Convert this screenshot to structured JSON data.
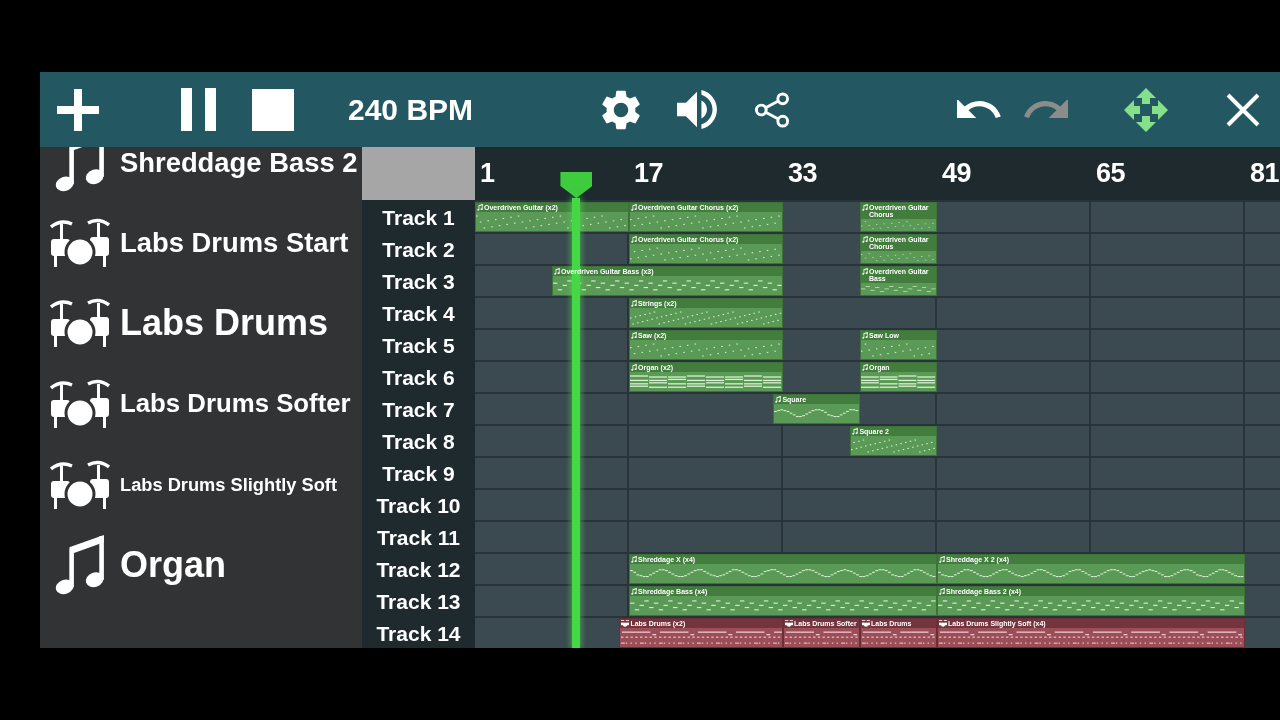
{
  "toolbar": {
    "transport": [
      {
        "kind": "add"
      },
      {
        "kind": "pause"
      },
      {
        "kind": "stop"
      }
    ],
    "tempo": "240 BPM",
    "tools": [
      {
        "kind": "settings"
      },
      {
        "kind": "volume"
      },
      {
        "kind": "share"
      }
    ],
    "history": [
      {
        "kind": "undo",
        "disabled": false
      },
      {
        "kind": "redo",
        "disabled": true
      }
    ],
    "view": [
      {
        "kind": "move",
        "active": true
      },
      {
        "kind": "close",
        "active": false
      }
    ]
  },
  "instruments": [
    {
      "name": "Shreddage Bass 2",
      "kind": "melodic"
    },
    {
      "name": "Labs Drums Start",
      "kind": "drums"
    },
    {
      "name": "Labs Drums",
      "kind": "drums"
    },
    {
      "name": "Labs Drums Softer",
      "kind": "drums"
    },
    {
      "name": "Labs Drums Slightly Soft",
      "kind": "drums"
    },
    {
      "name": "Organ",
      "kind": "melodic"
    }
  ],
  "ruler": {
    "marks": [
      "1",
      "17",
      "33",
      "49",
      "65",
      "81"
    ]
  },
  "playhead": {
    "level": 0.126
  },
  "tracks": [
    {
      "name": "Track 1",
      "clips": [
        {
          "name": "Overdriven Guitar (x2)",
          "kind": "melodic"
        },
        {
          "name": "Overdriven Guitar Chorus (x2)",
          "kind": "melodic"
        },
        {
          "name": "Overdriven Guitar Chorus",
          "kind": "melodic"
        }
      ]
    },
    {
      "name": "Track 2",
      "clips": [
        {
          "name": "Overdriven Guitar Chorus (x2)",
          "kind": "melodic"
        },
        {
          "name": "Overdriven Guitar Chorus",
          "kind": "melodic"
        }
      ]
    },
    {
      "name": "Track 3",
      "clips": [
        {
          "name": "Overdriven Guitar Bass (x3)",
          "kind": "melodic"
        },
        {
          "name": "Overdriven Guitar Bass",
          "kind": "melodic"
        }
      ]
    },
    {
      "name": "Track 4",
      "clips": [
        {
          "name": "Strings (x2)",
          "kind": "melodic"
        }
      ]
    },
    {
      "name": "Track 5",
      "clips": [
        {
          "name": "Saw (x2)",
          "kind": "melodic"
        },
        {
          "name": "Saw Low",
          "kind": "melodic"
        }
      ]
    },
    {
      "name": "Track 6",
      "clips": [
        {
          "name": "Organ (x2)",
          "kind": "melodic"
        },
        {
          "name": "Organ",
          "kind": "melodic"
        }
      ]
    },
    {
      "name": "Track 7",
      "clips": [
        {
          "name": "Square",
          "kind": "melodic"
        }
      ]
    },
    {
      "name": "Track 8",
      "clips": [
        {
          "name": "Square 2",
          "kind": "melodic"
        }
      ]
    },
    {
      "name": "Track 9"
    },
    {
      "name": "Track 10"
    },
    {
      "name": "Track 11"
    },
    {
      "name": "Track 12",
      "clips": [
        {
          "name": "Shreddage X (x4)",
          "kind": "melodic"
        },
        {
          "name": "Shreddage X 2 (x4)",
          "kind": "melodic"
        }
      ]
    },
    {
      "name": "Track 13",
      "clips": [
        {
          "name": "Shreddage Bass (x4)",
          "kind": "melodic"
        },
        {
          "name": "Shreddage Bass 2 (x4)",
          "kind": "melodic"
        }
      ]
    },
    {
      "name": "Track 14",
      "clips": [
        {
          "name": "Labs Drums (x2)",
          "kind": "drums"
        },
        {
          "name": "Labs Drums Softer",
          "kind": "drums"
        },
        {
          "name": "Labs Drums",
          "kind": "drums"
        },
        {
          "name": "Labs Drums Slightly Soft (x4)",
          "kind": "drums"
        }
      ]
    }
  ]
}
